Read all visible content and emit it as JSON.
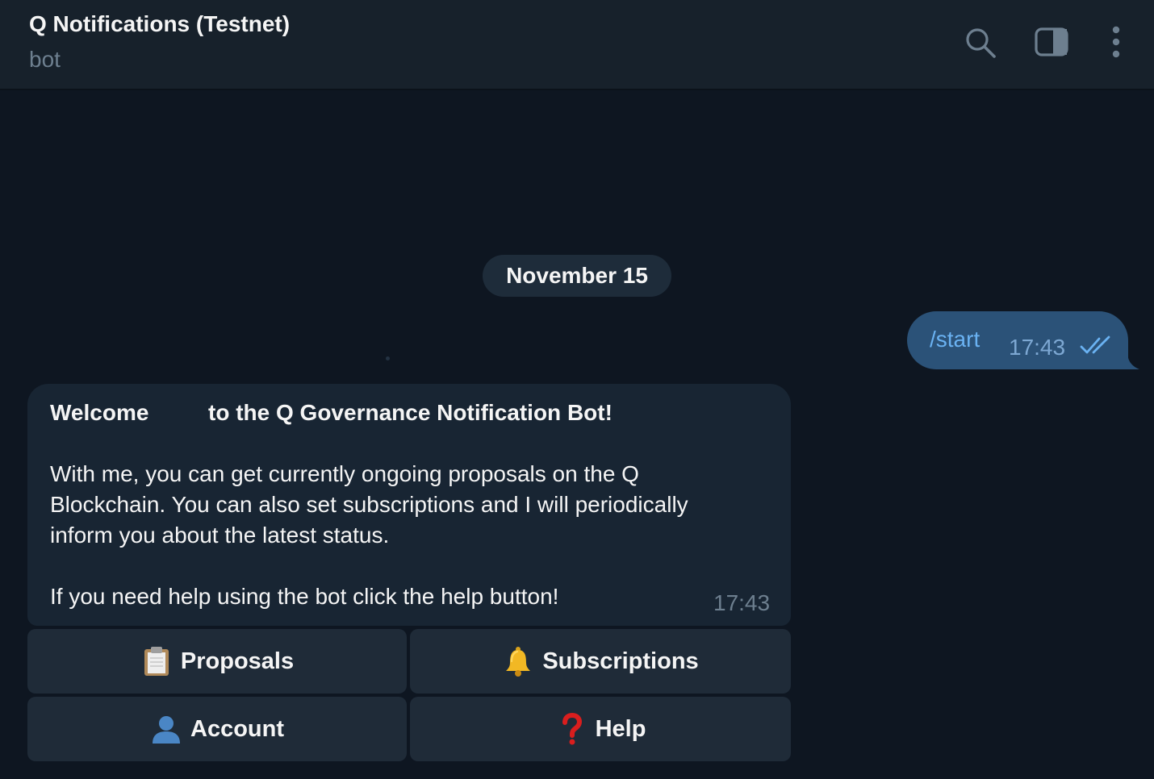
{
  "header": {
    "title": "Q Notifications (Testnet)",
    "subtitle": "bot",
    "icons": [
      "search-icon",
      "sidebar-toggle-icon",
      "more-vertical-icon"
    ]
  },
  "date_separator": "November 15",
  "outgoing_message": {
    "text": "/start",
    "time": "17:43",
    "status": "read"
  },
  "incoming_message": {
    "welcome_left": "Welcome",
    "welcome_right": "to the Q Governance Notification Bot!",
    "paragraph_lines": [
      "With me, you can get currently ongoing proposals on the Q",
      "Blockchain. You can also set subscriptions and I will periodically",
      "inform you about the latest status."
    ],
    "help_line": "If you need help using the bot click the help button!",
    "time": "17:43"
  },
  "keyboard": {
    "proposals": {
      "label": "Proposals",
      "icon": "clipboard-icon"
    },
    "subscriptions": {
      "label": "Subscriptions",
      "icon": "bell-icon"
    },
    "account": {
      "label": "Account",
      "icon": "user-silhouette-icon"
    },
    "help": {
      "label": "Help",
      "icon": "question-mark-icon"
    }
  },
  "colors": {
    "background": "#0e1621",
    "header": "#17212b",
    "outgoing_bubble": "#2b5278",
    "incoming_bubble": "#182533",
    "link": "#6ab2f2"
  }
}
